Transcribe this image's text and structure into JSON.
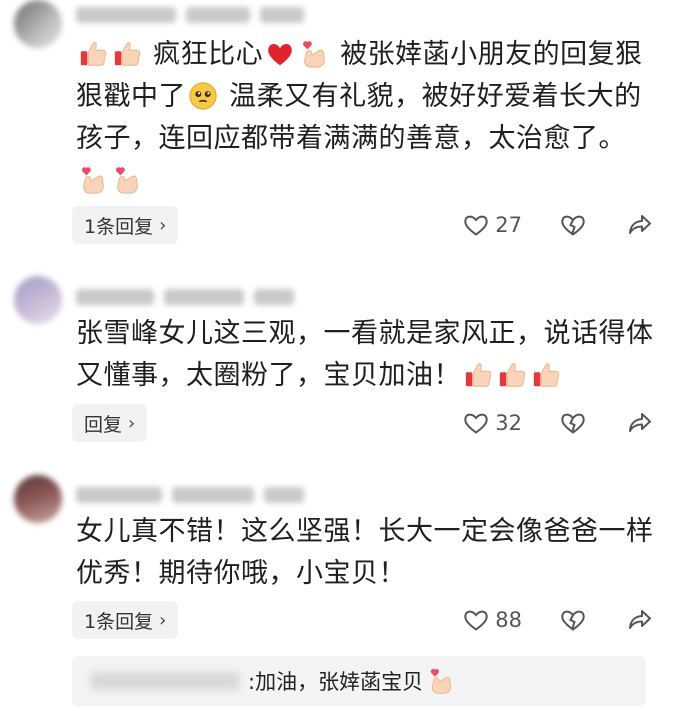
{
  "comments": [
    {
      "text_parts": [
        "疯狂比心",
        "被张婞菡小朋友的回复狠狠戳中了",
        "温柔又有礼貌，被好好爱着长大的孩子，连回应都带着满满的善意，太治愈了。"
      ],
      "reply_label": "1条回复",
      "like_count": "27"
    },
    {
      "text_parts": [
        "张雪峰女儿这三观，一看就是家风正，说话得体又懂事，太圈粉了，宝贝加油！"
      ],
      "reply_label": "回复",
      "like_count": "32"
    },
    {
      "text_parts": [
        "女儿真不错！这么坚强！长大一定会像爸爸一样优秀！期待你哦，小宝贝！"
      ],
      "reply_label": "1条回复",
      "like_count": "88"
    }
  ],
  "sub_reply": {
    "text": ":加油，张婞菡宝贝"
  },
  "icons": [
    "heart-outline-icon",
    "broken-heart-icon",
    "share-icon",
    "thumbs-up-emoji",
    "red-heart-emoji",
    "finger-heart-emoji",
    "teary-smile-emoji",
    "chevron-right-icon"
  ],
  "colors": {
    "pill_bg": "#f2f2f2",
    "icon_gray": "#555555",
    "heart_red": "#e0242f"
  }
}
